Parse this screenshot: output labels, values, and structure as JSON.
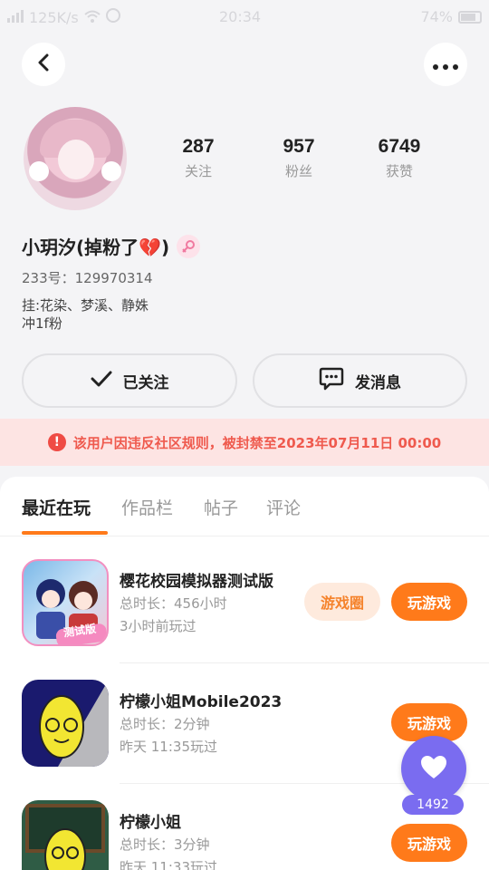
{
  "status_bar": {
    "network_speed": "125K/s",
    "time": "20:34",
    "battery": "74%"
  },
  "header": {
    "back_icon": "chevron-left-icon",
    "more_icon": "more-horizontal-icon"
  },
  "profile": {
    "avatar_icon": "user-avatar",
    "stats": [
      {
        "value": "287",
        "label": "关注"
      },
      {
        "value": "957",
        "label": "粉丝"
      },
      {
        "value": "6749",
        "label": "获赞"
      }
    ],
    "name": "小玥汐(掉粉了💔)",
    "gender_icon": "female-icon",
    "id_text": "233号：129970314",
    "bio_lines": [
      "挂:花染、梦溪、静姝",
      "冲1f粉"
    ]
  },
  "actions": {
    "follow_label": "已关注",
    "message_label": "发消息"
  },
  "ban_notice": "该用户因违反社区规则，被封禁至2023年07月11日 00:00",
  "tabs": [
    {
      "label": "最近在玩",
      "active": true
    },
    {
      "label": "作品栏",
      "active": false
    },
    {
      "label": "帖子",
      "active": false
    },
    {
      "label": "评论",
      "active": false
    }
  ],
  "games": [
    {
      "title": "樱花校园模拟器测试版",
      "duration": "总时长：456小时",
      "last_played": "3小时前玩过",
      "circle_label": "游戏圈",
      "play_label": "玩游戏",
      "icon_badge": "测试版"
    },
    {
      "title": "柠檬小姐Mobile2023",
      "duration": "总时长：2分钟",
      "last_played": "昨天 11:35玩过",
      "play_label": "玩游戏"
    },
    {
      "title": "柠檬小姐",
      "duration": "总时长：3分钟",
      "last_played": "昨天 11:33玩过",
      "play_label": "玩游戏"
    }
  ],
  "like_fab": {
    "count": "1492",
    "icon": "heart-icon"
  },
  "colors": {
    "accent": "#ff7a1a",
    "ban_text": "#ef5a4e",
    "ban_bg": "#fde4e3",
    "fab": "#7a6cf0"
  }
}
